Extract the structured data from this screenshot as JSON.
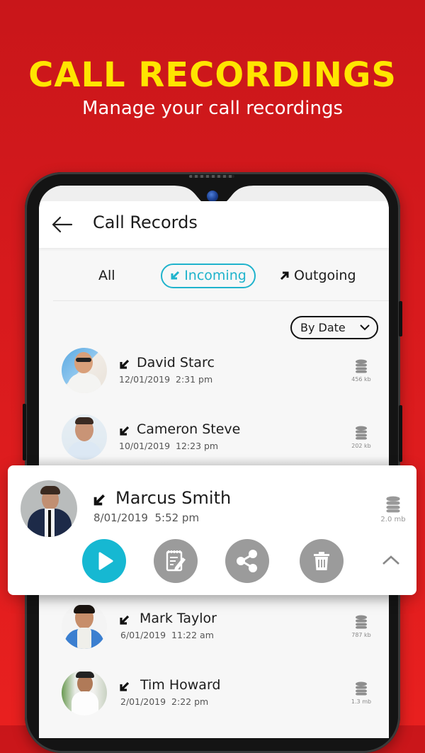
{
  "hero": {
    "title": "CALL RECORDINGS",
    "subtitle": "Manage your call recordings"
  },
  "colors": {
    "background": "#d71a1d",
    "hero_title": "#ffe500",
    "accent": "#16b8d2",
    "action_gray": "#9b9b9b"
  },
  "appbar": {
    "title": "Call Records",
    "back_icon": "arrow-left-icon"
  },
  "tabs": [
    {
      "label": "All",
      "active": false
    },
    {
      "label": "Incoming",
      "active": true,
      "icon": "arrow-down-left-icon"
    },
    {
      "label": "Outgoing",
      "active": false,
      "icon": "arrow-up-right-icon"
    }
  ],
  "sort": {
    "label": "By Date",
    "icon": "chevron-down-icon"
  },
  "records": [
    {
      "name": "David Starc",
      "date": "12/01/2019",
      "time": "2:31 pm",
      "size": "456 kb",
      "direction": "incoming"
    },
    {
      "name": "Cameron Steve",
      "date": "10/01/2019",
      "time": "12:23 pm",
      "size": "202 kb",
      "direction": "incoming"
    },
    {
      "name": "Marcus Smith",
      "date": "8/01/2019",
      "time": "5:52 pm",
      "size": "2.0 mb",
      "direction": "incoming",
      "expanded": true
    },
    {
      "name": "Mark Taylor",
      "date": "6/01/2019",
      "time": "11:22 am",
      "size": "787 kb",
      "direction": "incoming"
    },
    {
      "name": "Tim Howard",
      "date": "2/01/2019",
      "time": "2:22 pm",
      "size": "1.3 mb",
      "direction": "incoming"
    }
  ],
  "expanded_actions": [
    {
      "name": "play",
      "icon": "play-icon"
    },
    {
      "name": "notes",
      "icon": "notepad-edit-icon"
    },
    {
      "name": "share",
      "icon": "share-icon"
    },
    {
      "name": "delete",
      "icon": "trash-icon"
    }
  ],
  "collapse_icon": "chevron-up-icon"
}
